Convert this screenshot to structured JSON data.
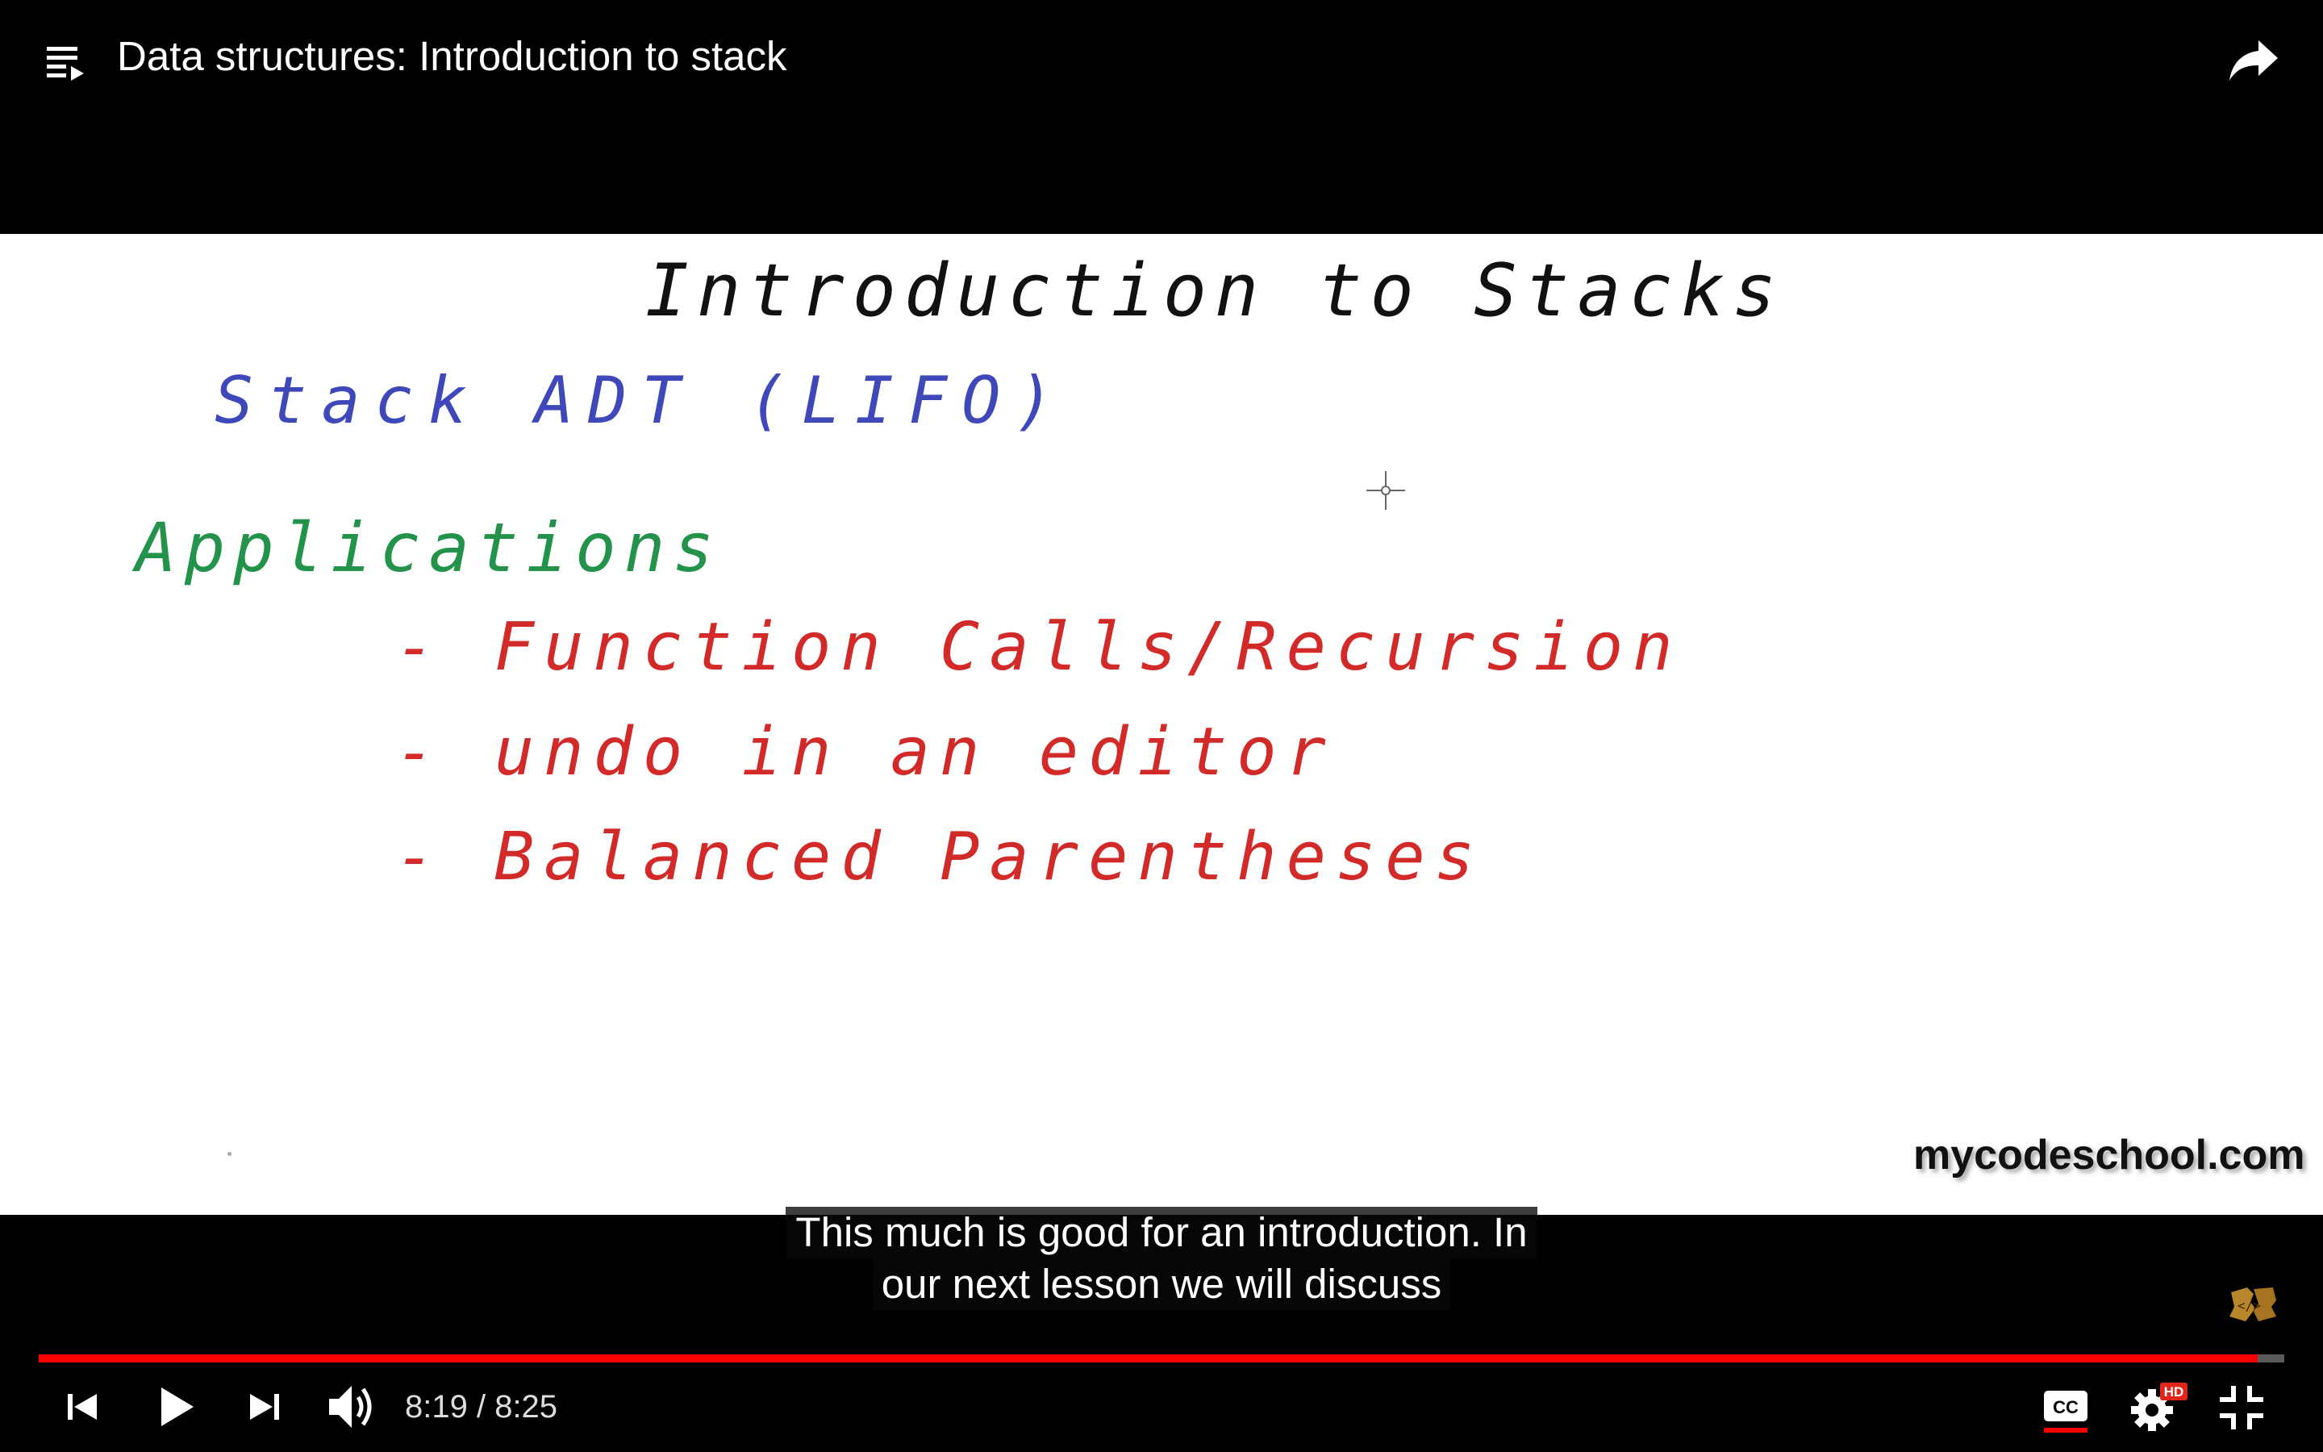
{
  "header": {
    "title": "Data structures: Introduction to stack",
    "playlist_icon": "playlist-icon",
    "share_icon": "share-arrow-icon"
  },
  "whiteboard": {
    "heading": "Introduction to Stacks",
    "adt_line": "Stack ADT (LIFO)",
    "applications_label": "Applications",
    "items": [
      "- Function Calls/Recursion",
      "- undo in an editor",
      "- Balanced Parentheses"
    ],
    "watermark": "mycodeschool.com",
    "colors": {
      "heading": "#111111",
      "adt_line": "#3f48b8",
      "applications_label": "#23924a",
      "items": "#d22a28"
    }
  },
  "captions": {
    "lines": [
      "This much is good for an introduction. In",
      "our next lesson we will discuss"
    ]
  },
  "player": {
    "progress_fraction": 0.988,
    "current_time": "8:19",
    "duration": "8:25",
    "time_separator": "/",
    "time_text": "8:19 / 8:25",
    "hd_badge": "HD",
    "cc_label": "CC",
    "accent_color": "#ff0000",
    "icons": [
      "previous-icon",
      "play-icon",
      "next-icon",
      "volume-icon",
      "captions-icon",
      "settings-icon",
      "exit-fullscreen-icon"
    ]
  }
}
